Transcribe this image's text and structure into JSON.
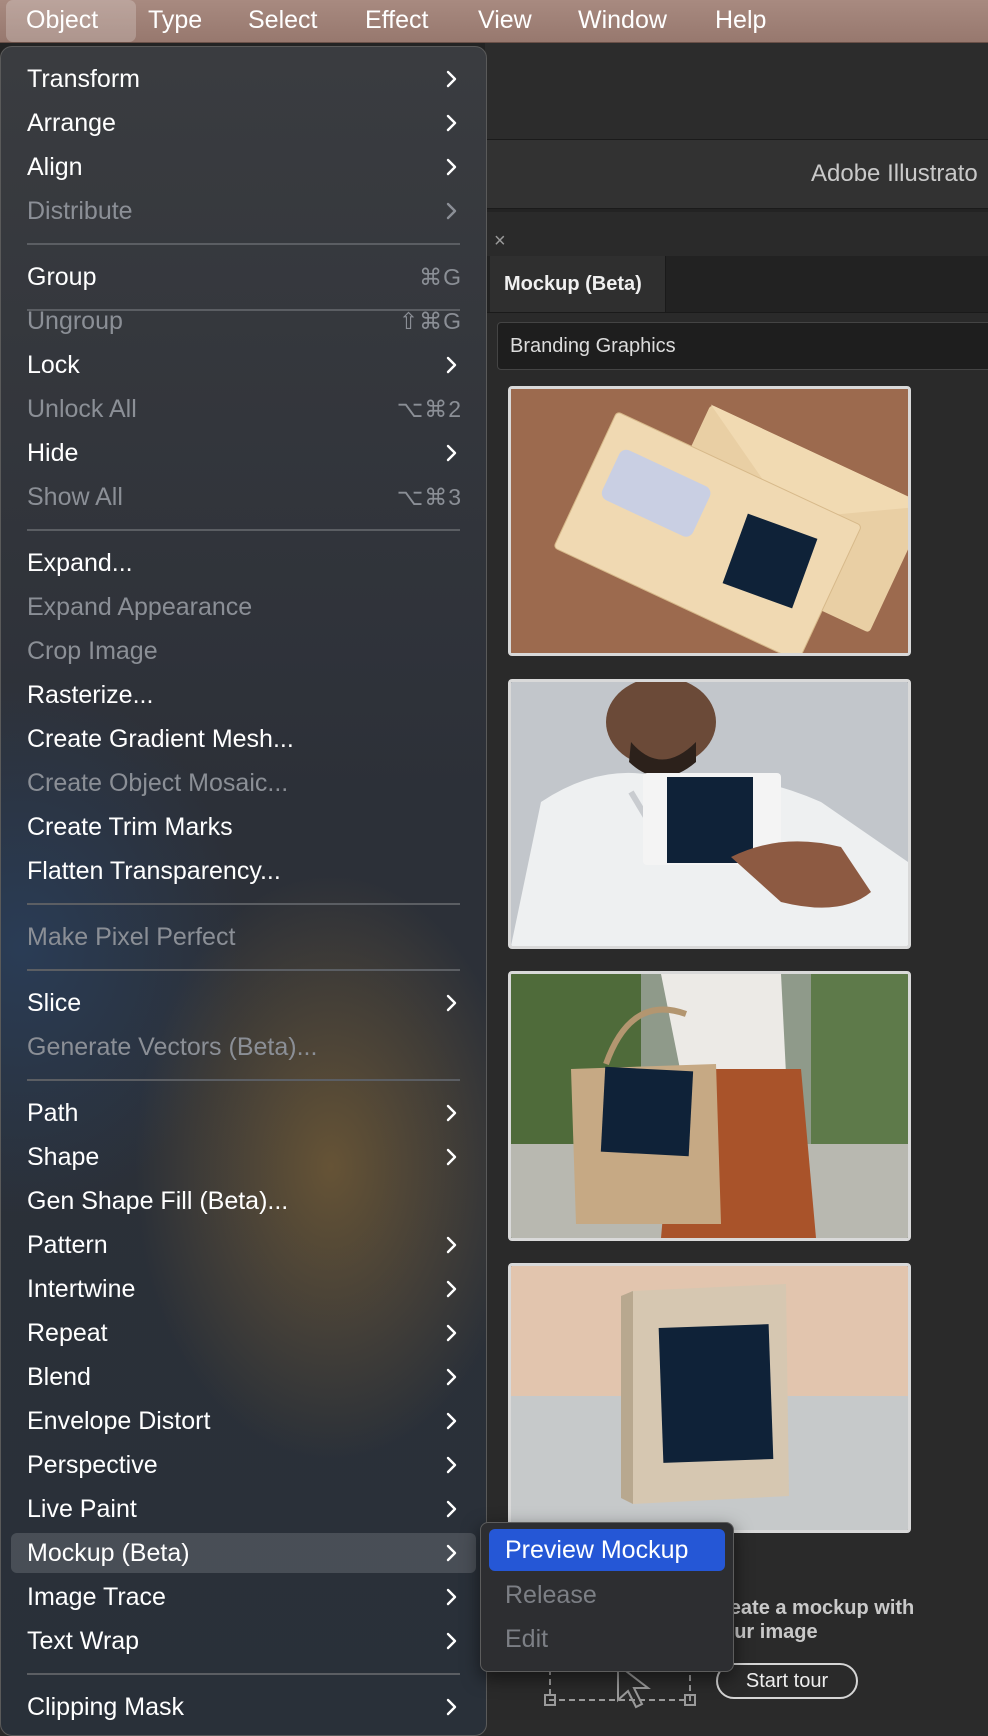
{
  "menubar": {
    "items": [
      "Object",
      "Type",
      "Select",
      "Effect",
      "View",
      "Window",
      "Help"
    ],
    "active": "Object"
  },
  "app": {
    "title": "Adobe Illustrato",
    "panel": {
      "close_glyph": "×",
      "tab": "Mockup (Beta)",
      "dropdown_value": "Branding Graphics",
      "thumbnails": [
        "envelope-mockup",
        "business-card-mockup",
        "tote-bag-mockup",
        "book-mockup"
      ],
      "promo_line1": "reate a mockup with",
      "promo_line2": "our image",
      "start_tour": "Start tour"
    }
  },
  "object_menu": {
    "items": [
      {
        "label": "Transform",
        "submenu": true
      },
      {
        "label": "Arrange",
        "submenu": true
      },
      {
        "label": "Align",
        "submenu": true
      },
      {
        "label": "Distribute",
        "submenu": true,
        "disabled": true
      },
      {
        "label": "Group",
        "shortcut": "⌘G"
      },
      {
        "label": "Ungroup",
        "shortcut": "⇧⌘G",
        "disabled": true
      },
      {
        "label": "Lock",
        "submenu": true
      },
      {
        "label": "Unlock All",
        "shortcut": "⌥⌘2",
        "disabled": true
      },
      {
        "label": "Hide",
        "submenu": true
      },
      {
        "label": "Show All",
        "shortcut": "⌥⌘3",
        "disabled": true
      },
      {
        "label": "Expand..."
      },
      {
        "label": "Expand Appearance",
        "disabled": true
      },
      {
        "label": "Crop Image",
        "disabled": true
      },
      {
        "label": "Rasterize..."
      },
      {
        "label": "Create Gradient Mesh..."
      },
      {
        "label": "Create Object Mosaic...",
        "disabled": true
      },
      {
        "label": "Create Trim Marks"
      },
      {
        "label": "Flatten Transparency..."
      },
      {
        "label": "Make Pixel Perfect",
        "disabled": true
      },
      {
        "label": "Slice",
        "submenu": true
      },
      {
        "label": "Generate Vectors (Beta)...",
        "disabled": true
      },
      {
        "label": "Path",
        "submenu": true
      },
      {
        "label": "Shape",
        "submenu": true
      },
      {
        "label": "Gen Shape Fill (Beta)..."
      },
      {
        "label": "Pattern",
        "submenu": true
      },
      {
        "label": "Intertwine",
        "submenu": true
      },
      {
        "label": "Repeat",
        "submenu": true
      },
      {
        "label": "Blend",
        "submenu": true
      },
      {
        "label": "Envelope Distort",
        "submenu": true
      },
      {
        "label": "Perspective",
        "submenu": true
      },
      {
        "label": "Live Paint",
        "submenu": true
      },
      {
        "label": "Mockup (Beta)",
        "submenu": true,
        "highlighted": true
      },
      {
        "label": "Image Trace",
        "submenu": true
      },
      {
        "label": "Text Wrap",
        "submenu": true
      },
      {
        "label": "Clipping Mask",
        "submenu": true
      }
    ]
  },
  "mockup_submenu": {
    "items": [
      {
        "label": "Preview Mockup",
        "selected": true
      },
      {
        "label": "Release",
        "disabled": true
      },
      {
        "label": "Edit",
        "disabled": true
      }
    ]
  },
  "colors": {
    "menubar": "#9c7d73",
    "selection_blue": "#2557d6",
    "artwork_navy": "#0f2238"
  }
}
